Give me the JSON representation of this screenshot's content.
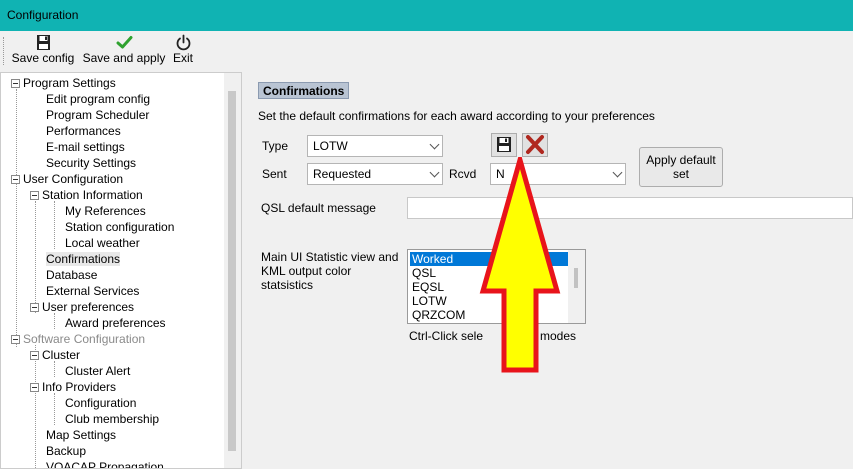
{
  "window": {
    "title": "Configuration"
  },
  "toolbar": {
    "save_config": "Save config",
    "save_and_apply": "Save and apply",
    "exit": "Exit"
  },
  "tree": {
    "items": [
      {
        "label": "Program Settings"
      },
      {
        "label": "Edit program config"
      },
      {
        "label": "Program Scheduler"
      },
      {
        "label": "Performances"
      },
      {
        "label": "E-mail settings"
      },
      {
        "label": "Security Settings"
      },
      {
        "label": "User Configuration"
      },
      {
        "label": "Station Information"
      },
      {
        "label": "My References"
      },
      {
        "label": "Station configuration"
      },
      {
        "label": "Local weather"
      },
      {
        "label": "Confirmations"
      },
      {
        "label": "Database"
      },
      {
        "label": "External Services"
      },
      {
        "label": "User preferences"
      },
      {
        "label": "Award preferences"
      },
      {
        "label": "Software Configuration"
      },
      {
        "label": "Cluster"
      },
      {
        "label": "Cluster Alert"
      },
      {
        "label": "Info Providers"
      },
      {
        "label": "Configuration"
      },
      {
        "label": "Club membership"
      },
      {
        "label": "Map Settings"
      },
      {
        "label": "Backup"
      },
      {
        "label": "VOACAP Propagation"
      }
    ]
  },
  "confirmations": {
    "header": "Confirmations",
    "description": "Set the default confirmations for each award according to your preferences",
    "type_label": "Type",
    "type_value": "LOTW",
    "sent_label": "Sent",
    "sent_value": "Requested",
    "rcvd_label": "Rcvd",
    "rcvd_value": "N",
    "apply_default_set": "Apply default set",
    "qsl_message_label": "QSL default message",
    "qsl_message_value": "",
    "stat_label": "Main UI Statistic view and KML output color statsistics",
    "stat_options": [
      "Worked",
      "QSL",
      "EQSL",
      "LOTW",
      "QRZCOM"
    ],
    "stat_selected": "Worked",
    "hint_left": "Ctrl-Click sele",
    "hint_right": "modes"
  },
  "colors": {
    "titlebar": "#10b3b3",
    "selection": "#0078d7",
    "arrow_fill": "#ffff00",
    "arrow_stroke": "#e8141b"
  }
}
